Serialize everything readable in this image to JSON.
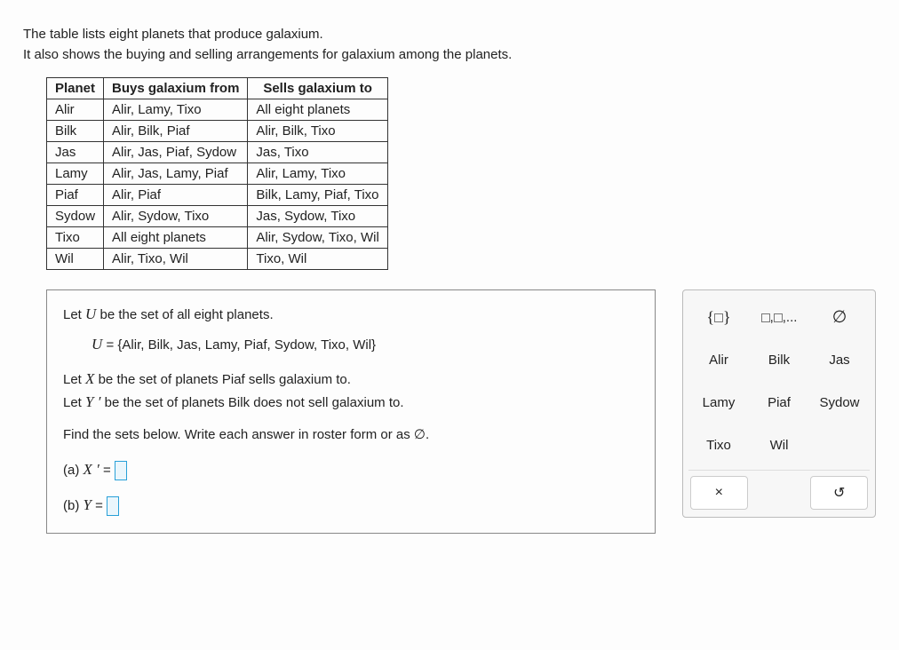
{
  "intro": {
    "line1": "The table lists eight planets that produce galaxium.",
    "line2": "It also shows the buying and selling arrangements for galaxium among the planets."
  },
  "table": {
    "headers": [
      "Planet",
      "Buys galaxium from",
      "Sells galaxium to"
    ],
    "rows": [
      {
        "planet": "Alir",
        "buys": "Alir, Lamy, Tixo",
        "sells": "All eight planets"
      },
      {
        "planet": "Bilk",
        "buys": "Alir, Bilk, Piaf",
        "sells": "Alir, Bilk, Tixo"
      },
      {
        "planet": "Jas",
        "buys": "Alir, Jas, Piaf, Sydow",
        "sells": "Jas, Tixo"
      },
      {
        "planet": "Lamy",
        "buys": "Alir, Jas, Lamy, Piaf",
        "sells": "Alir, Lamy, Tixo"
      },
      {
        "planet": "Piaf",
        "buys": "Alir, Piaf",
        "sells": "Bilk, Lamy, Piaf, Tixo"
      },
      {
        "planet": "Sydow",
        "buys": "Alir, Sydow, Tixo",
        "sells": "Jas, Sydow, Tixo"
      },
      {
        "planet": "Tixo",
        "buys": "All eight planets",
        "sells": "Alir, Sydow, Tixo, Wil"
      },
      {
        "planet": "Wil",
        "buys": "Alir, Tixo, Wil",
        "sells": "Tixo, Wil"
      }
    ]
  },
  "question": {
    "letU_pre": "Let ",
    "letU_var": "U",
    "letU_post": " be the set of all eight planets.",
    "U_def_var": "U",
    "U_def_eq": " = ",
    "U_def_set": "{Alir,  Bilk,  Jas,  Lamy,  Piaf,  Sydow,  Tixo,  Wil}",
    "letX_pre": "Let ",
    "letX_var": "X",
    "letX_post": " be the set of planets Piaf sells galaxium to.",
    "letY_pre": "Let ",
    "letY_var": "Y ′",
    "letY_post": " be the set of planets Bilk does not sell galaxium to.",
    "find": "Find the sets below. Write each answer in roster form or as ∅.",
    "a_label": "(a)   ",
    "a_var": "X ′",
    "a_eq": " = ",
    "b_label": "(b)   ",
    "b_var": "Y",
    "b_eq": " = "
  },
  "palette": {
    "braces": "{ □ }",
    "roster": "□,□,...",
    "empty": "∅",
    "planets": [
      "Alir",
      "Bilk",
      "Jas",
      "Lamy",
      "Piaf",
      "Sydow",
      "Tixo",
      "Wil"
    ],
    "clear_icon": "×",
    "reset_icon": "↺"
  }
}
